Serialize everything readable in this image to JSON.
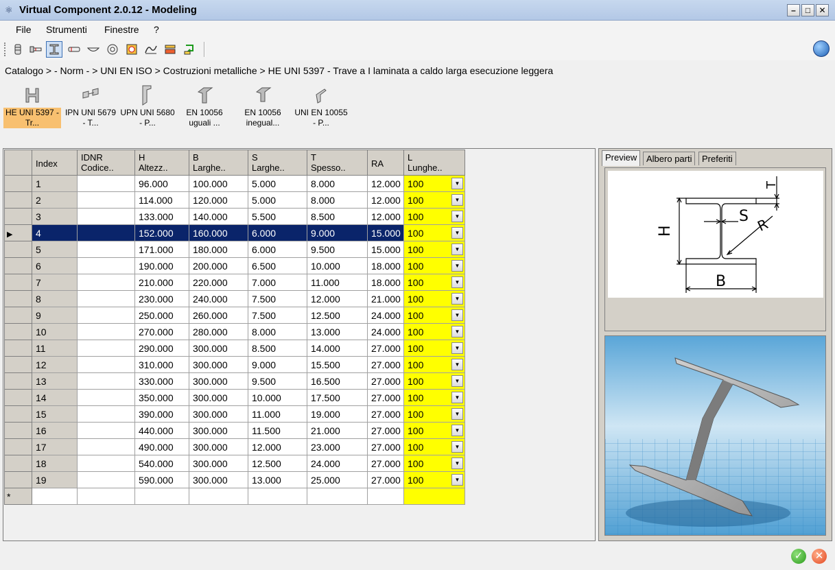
{
  "window": {
    "title": "Virtual Component 2.0.12 - Modeling"
  },
  "menu": [
    "File",
    "Strumenti",
    "Finestre",
    "?"
  ],
  "toolbar": {
    "tools": [
      "bolt-icon",
      "screw-icon",
      "i-beam-icon",
      "pin-icon",
      "washer-icon",
      "ring-icon",
      "bearing-icon",
      "spring-icon",
      "profile-icon",
      "export-icon"
    ],
    "active_tool": "i-beam-icon"
  },
  "breadcrumb": "Catalogo > - Norm - > UNI EN ISO > Costruzioni metalliche > HE UNI 5397 - Trave a I laminata a caldo  larga  esecuzione leggera",
  "catalog": [
    {
      "line1": "HE UNI 5397 -",
      "line2": "Tr...",
      "selected": true
    },
    {
      "line1": "IPN UNI 5679",
      "line2": "- T...",
      "selected": false
    },
    {
      "line1": "UPN UNI 5680",
      "line2": "- P...",
      "selected": false
    },
    {
      "line1": "EN 10056",
      "line2": "uguali ...",
      "selected": false
    },
    {
      "line1": "EN 10056",
      "line2": "inegual...",
      "selected": false
    },
    {
      "line1": "UNI EN 10055",
      "line2": "- P...",
      "selected": false
    }
  ],
  "grid": {
    "columns": [
      {
        "line1": "Index",
        "line2": ""
      },
      {
        "line1": "IDNR",
        "line2": "Codice.."
      },
      {
        "line1": "H",
        "line2": "Altezz.."
      },
      {
        "line1": "B",
        "line2": "Larghe.."
      },
      {
        "line1": "S",
        "line2": "Larghe.."
      },
      {
        "line1": "T",
        "line2": "Spesso.."
      },
      {
        "line1": "RA",
        "line2": ""
      },
      {
        "line1": "L",
        "line2": "Lunghe.."
      }
    ],
    "selected_index": "4",
    "new_row_marker": "*",
    "rows": [
      [
        "1",
        "",
        "96.000",
        "100.000",
        "5.000",
        "8.000",
        "12.000",
        "100"
      ],
      [
        "2",
        "",
        "114.000",
        "120.000",
        "5.000",
        "8.000",
        "12.000",
        "100"
      ],
      [
        "3",
        "",
        "133.000",
        "140.000",
        "5.500",
        "8.500",
        "12.000",
        "100"
      ],
      [
        "4",
        "",
        "152.000",
        "160.000",
        "6.000",
        "9.000",
        "15.000",
        "100"
      ],
      [
        "5",
        "",
        "171.000",
        "180.000",
        "6.000",
        "9.500",
        "15.000",
        "100"
      ],
      [
        "6",
        "",
        "190.000",
        "200.000",
        "6.500",
        "10.000",
        "18.000",
        "100"
      ],
      [
        "7",
        "",
        "210.000",
        "220.000",
        "7.000",
        "11.000",
        "18.000",
        "100"
      ],
      [
        "8",
        "",
        "230.000",
        "240.000",
        "7.500",
        "12.000",
        "21.000",
        "100"
      ],
      [
        "9",
        "",
        "250.000",
        "260.000",
        "7.500",
        "12.500",
        "24.000",
        "100"
      ],
      [
        "10",
        "",
        "270.000",
        "280.000",
        "8.000",
        "13.000",
        "24.000",
        "100"
      ],
      [
        "11",
        "",
        "290.000",
        "300.000",
        "8.500",
        "14.000",
        "27.000",
        "100"
      ],
      [
        "12",
        "",
        "310.000",
        "300.000",
        "9.000",
        "15.500",
        "27.000",
        "100"
      ],
      [
        "13",
        "",
        "330.000",
        "300.000",
        "9.500",
        "16.500",
        "27.000",
        "100"
      ],
      [
        "14",
        "",
        "350.000",
        "300.000",
        "10.000",
        "17.500",
        "27.000",
        "100"
      ],
      [
        "15",
        "",
        "390.000",
        "300.000",
        "11.000",
        "19.000",
        "27.000",
        "100"
      ],
      [
        "16",
        "",
        "440.000",
        "300.000",
        "11.500",
        "21.000",
        "27.000",
        "100"
      ],
      [
        "17",
        "",
        "490.000",
        "300.000",
        "12.000",
        "23.000",
        "27.000",
        "100"
      ],
      [
        "18",
        "",
        "540.000",
        "300.000",
        "12.500",
        "24.000",
        "27.000",
        "100"
      ],
      [
        "19",
        "",
        "590.000",
        "300.000",
        "13.000",
        "25.000",
        "27.000",
        "100"
      ]
    ]
  },
  "tabs": [
    "Preview",
    "Albero parti",
    "Preferiti"
  ],
  "preview_labels": {
    "h": "H",
    "t": "T",
    "s": "S",
    "r": "R",
    "b": "B"
  },
  "colors": {
    "selected_row": "#0a246a",
    "length_column": "#ffff00",
    "catalog_selected": "#f8c070"
  }
}
